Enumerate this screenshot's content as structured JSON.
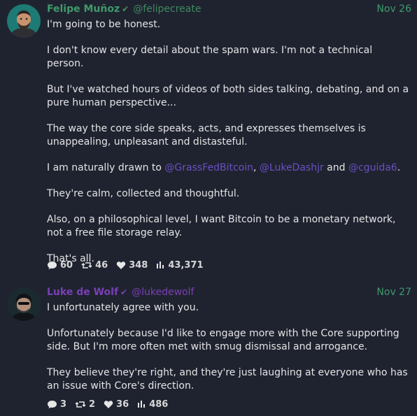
{
  "colors": {
    "background": "#1f2330",
    "post1_accent": "#3f9a6a",
    "post2_accent": "#7a3fb5",
    "mention": "#6b4fc1"
  },
  "posts": [
    {
      "author": {
        "name": "Felipe Muñoz",
        "handle": "@felipecreate",
        "verified_icon": "check-icon",
        "avatar_icon": "user-avatar"
      },
      "date": "Nov 26",
      "content": {
        "p1": "I'm going to be honest.",
        "p2": "I don't know every detail about the spam wars. I'm not a technical person.",
        "p3": "But I've watched hours of videos of both sides talking, debating, and on a pure human perspective...",
        "p4": "The way the core side speaks, acts, and expresses themselves is unappealing, unpleasant and distasteful.",
        "p5_prefix": "I am naturally drawn to ",
        "mention1": "@GrassFedBitcoin",
        "sep1": ", ",
        "mention2": "@LukeDashjr",
        "sep2": " and ",
        "mention3": "@cguida6",
        "p5_suffix": ".",
        "p6": "They're calm, collected and thoughtful.",
        "p7": "Also, on a philosophical level, I want Bitcoin to be a monetary network, not a free file storage relay.",
        "p8": "That's all."
      },
      "stats": {
        "replies": "60",
        "reposts": "46",
        "likes": "348",
        "views": "43,371"
      }
    },
    {
      "author": {
        "name": "Luke de Wolf",
        "handle": "@lukedewolf",
        "verified_icon": "check-icon",
        "avatar_icon": "user-avatar"
      },
      "date": "Nov 27",
      "content": {
        "p1": "I unfortunately agree with you.",
        "p2": "Unfortunately because I'd like to engage more with the Core supporting side. But I'm more often met with smug dismissal and arrogance.",
        "p3": "They believe they're right, and they're just laughing at everyone who has an issue with Core's direction."
      },
      "stats": {
        "replies": "3",
        "reposts": "2",
        "likes": "36",
        "views": "486"
      }
    }
  ]
}
